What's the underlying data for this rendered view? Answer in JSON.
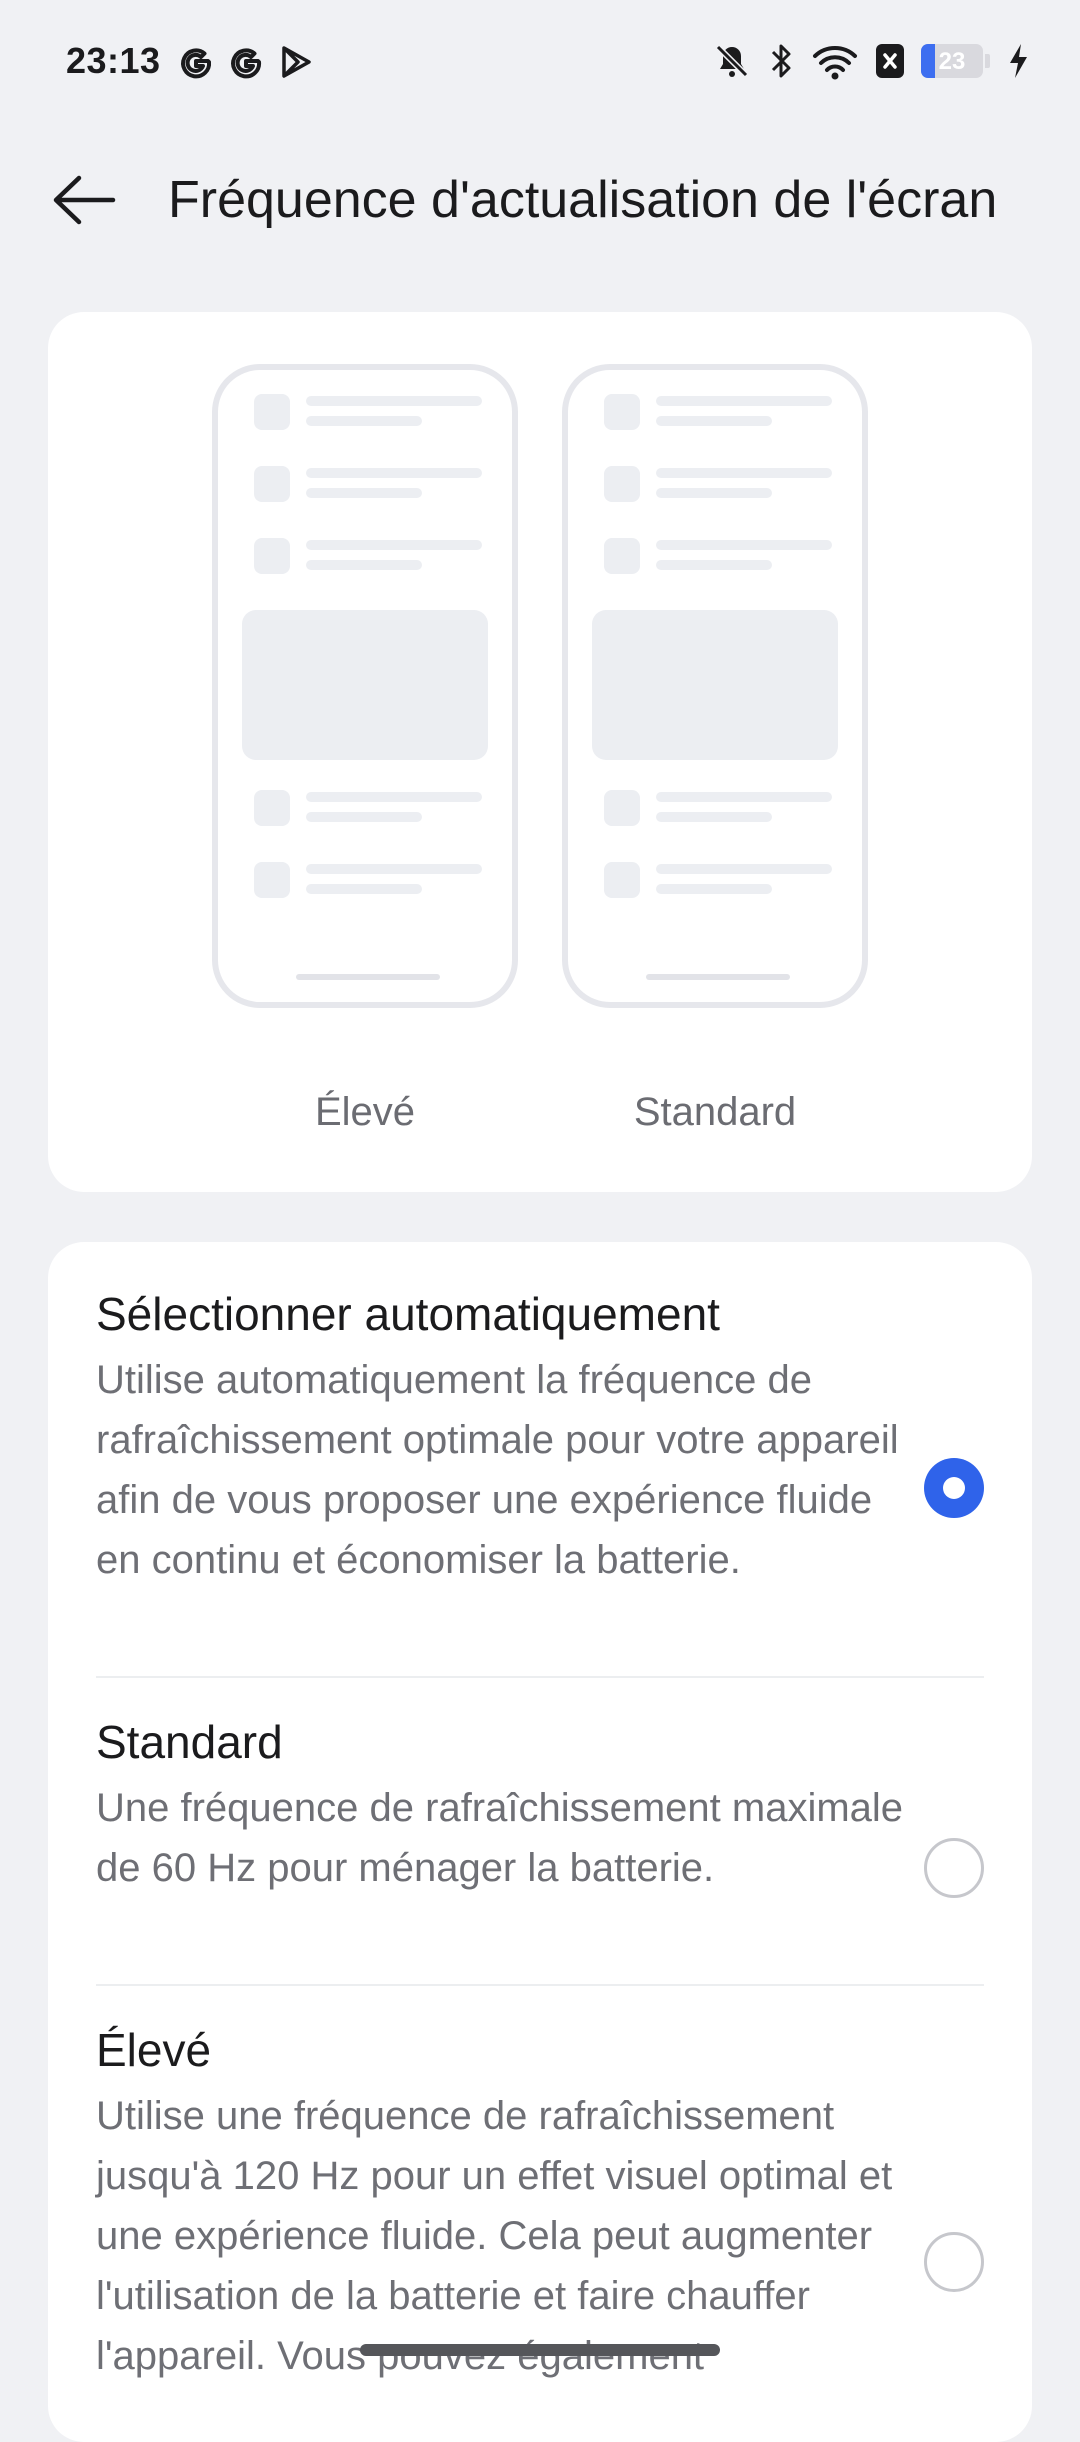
{
  "status_bar": {
    "time": "23:13",
    "left_icons": [
      "google-icon",
      "google-icon",
      "play-store-icon"
    ],
    "right_icons": [
      "bell-off-icon",
      "bluetooth-icon",
      "wifi-icon",
      "sim-x-icon",
      "battery-icon",
      "charging-icon"
    ],
    "battery_percent": "23",
    "battery_level": 0.23
  },
  "header": {
    "title": "Fréquence d'actualisation de l'écran",
    "back_icon": "arrow-left-icon"
  },
  "preview": {
    "labels": [
      "Élevé",
      "Standard"
    ]
  },
  "options": [
    {
      "title": "Sélectionner automatiquement",
      "description": "Utilise automatiquement la fréquence de rafraîchissement optimale pour votre appareil afin de vous proposer une expérience fluide en continu et économiser la batterie.",
      "selected": true
    },
    {
      "title": "Standard",
      "description": "Une fréquence de rafraîchissement maximale de 60 Hz pour ménager la batterie.",
      "selected": false
    },
    {
      "title": "Élevé",
      "description": "Utilise une fréquence de rafraîchissement jusqu'à 120 Hz pour un effet visuel optimal et une expérience fluide. Cela peut augmenter l'utilisation de la batterie et faire chauffer l'appareil. Vous pouvez également",
      "selected": false
    }
  ],
  "colors": {
    "accent": "#2f63ea",
    "background": "#f0f1f4",
    "card": "#ffffff"
  }
}
